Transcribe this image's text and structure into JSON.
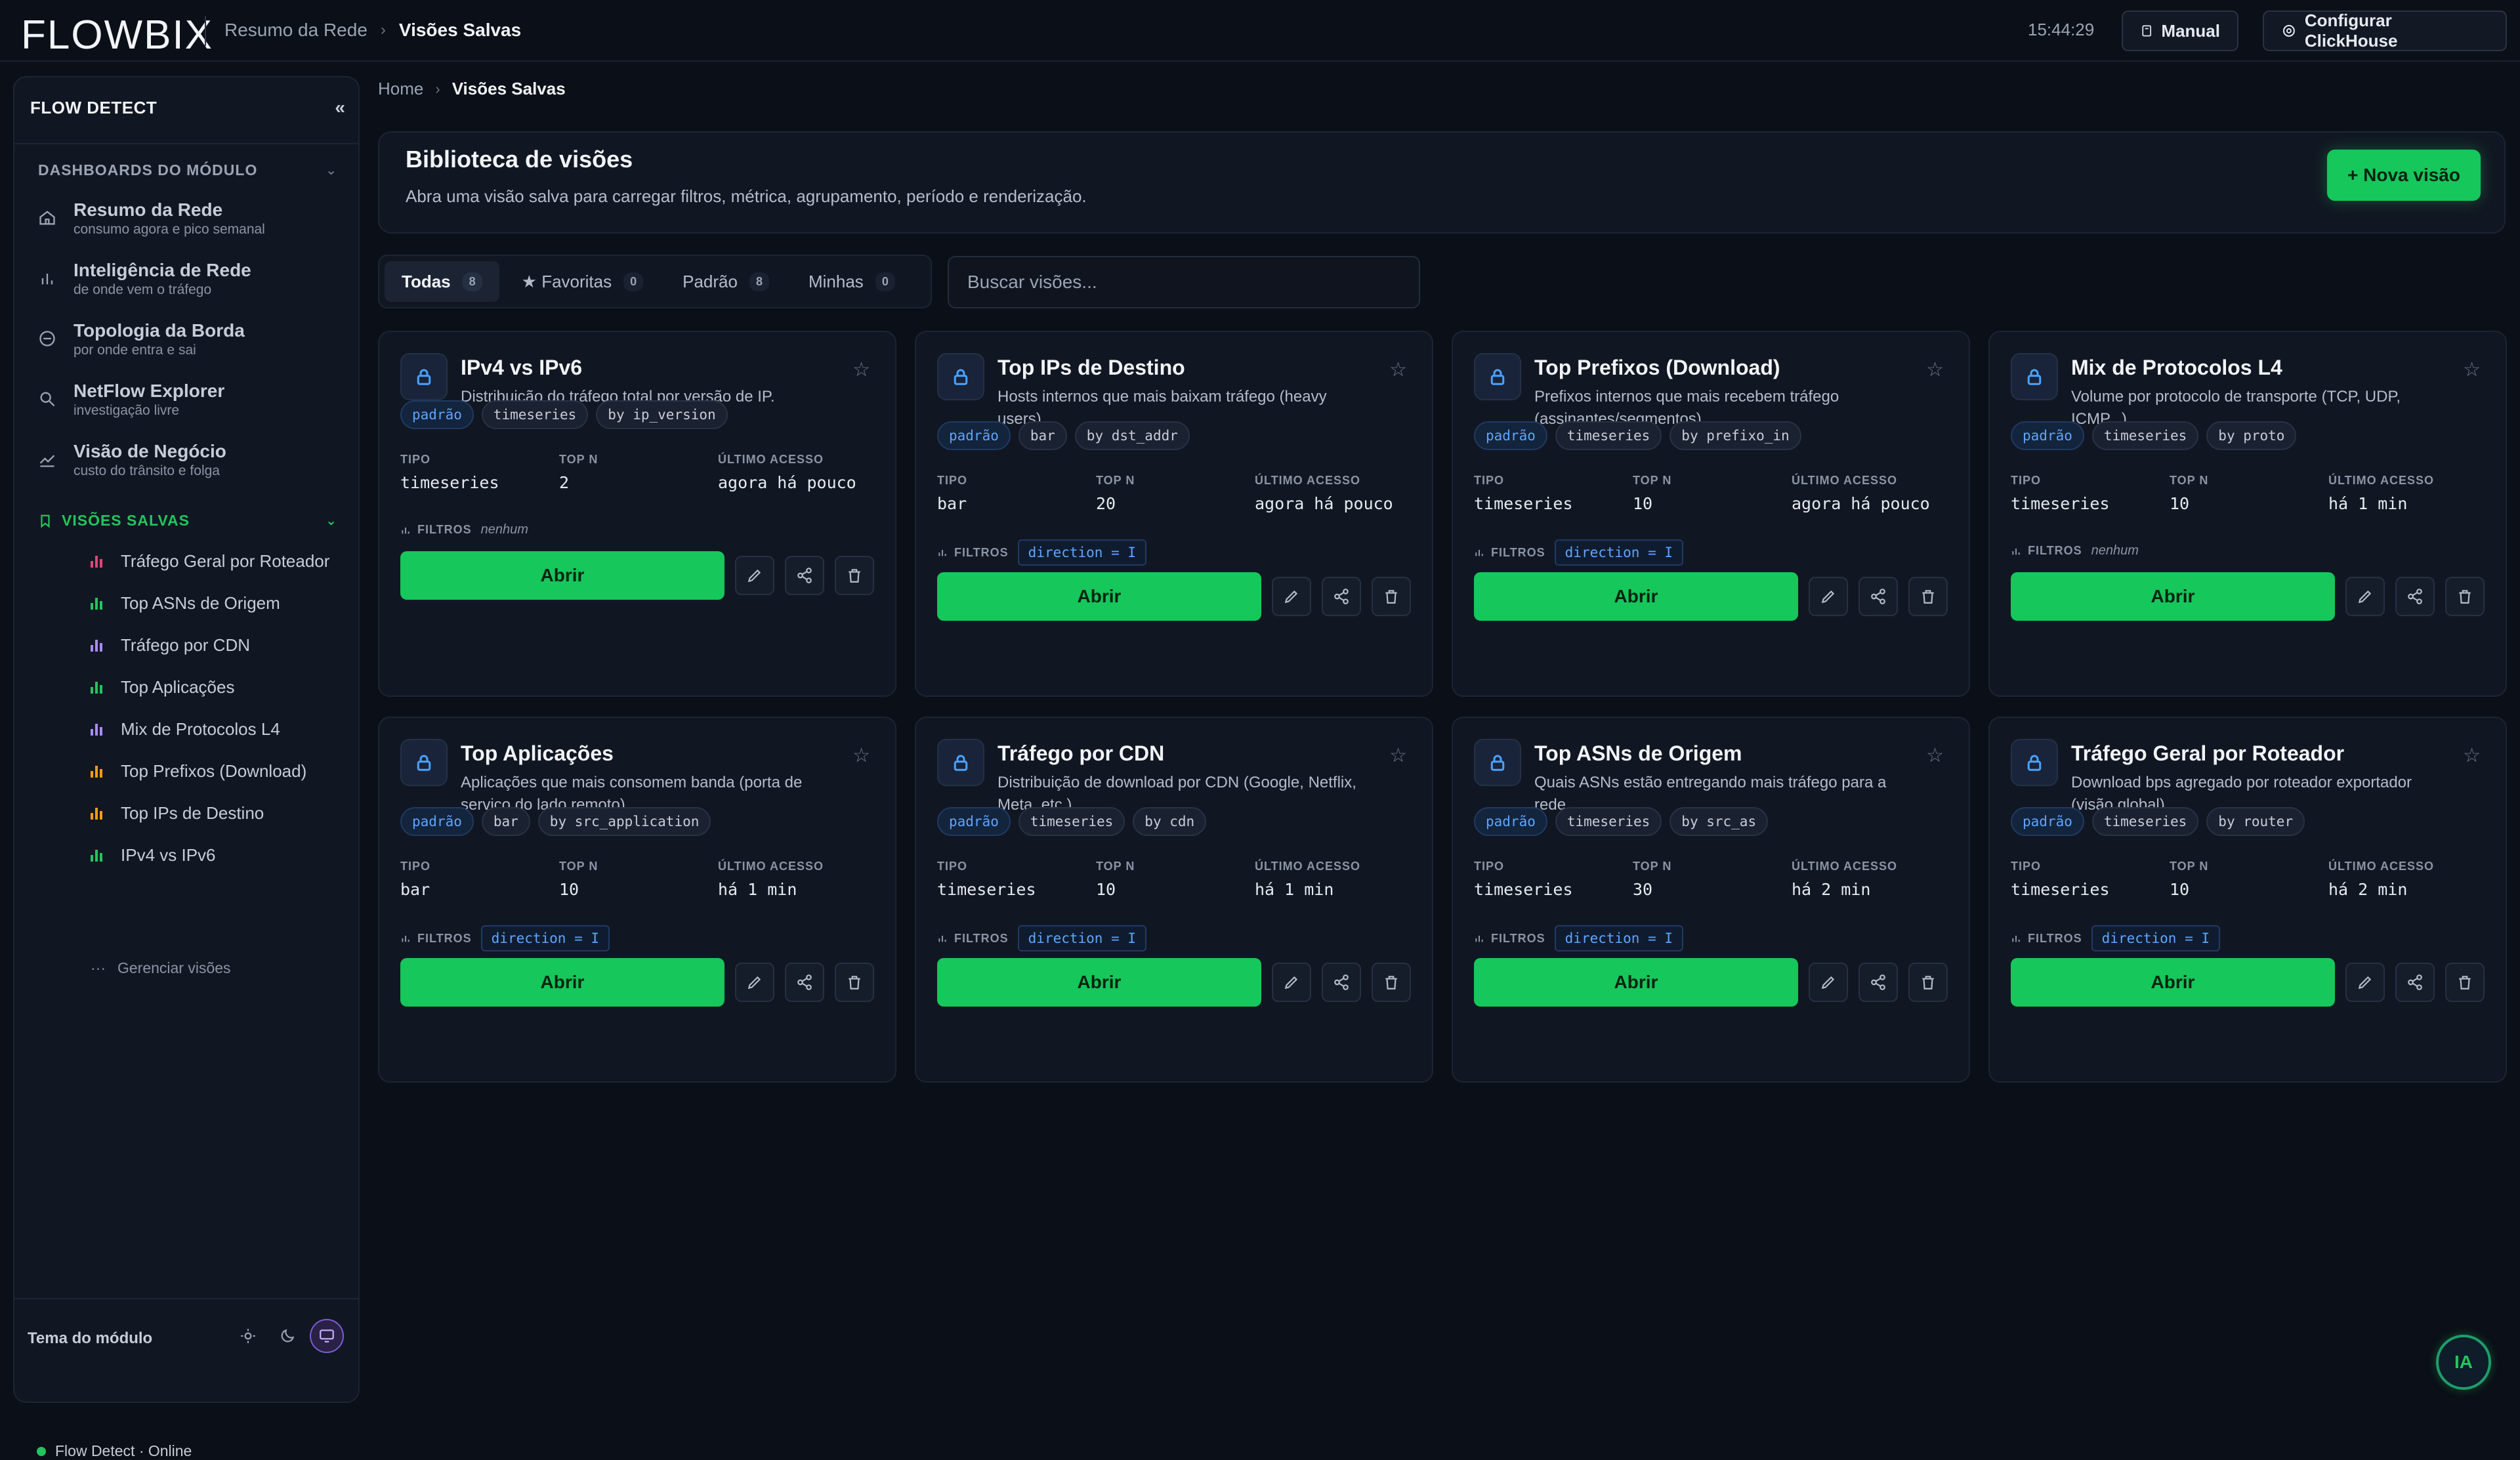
{
  "app": {
    "logo": "FLOWBIX",
    "breadcrumb_parent": "Resumo da Rede",
    "breadcrumb_current": "Visões Salvas",
    "clock": "15:44:29",
    "manual_label": "Manual",
    "config_label": "Configurar ClickHouse"
  },
  "sidebar": {
    "title": "FLOW DETECT",
    "collapse": "«",
    "section_dashboards": "DASHBOARDS DO MÓDULO",
    "nav": [
      {
        "label": "Resumo da Rede",
        "sub": "consumo agora e pico semanal",
        "icon": "home-icon"
      },
      {
        "label": "Inteligência de Rede",
        "sub": "de onde vem o tráfego",
        "icon": "bar-chart-icon"
      },
      {
        "label": "Topologia da Borda",
        "sub": "por onde entra e sai",
        "icon": "network-icon"
      },
      {
        "label": "NetFlow Explorer",
        "sub": "investigação livre",
        "icon": "search-icon"
      },
      {
        "label": "Visão de Negócio",
        "sub": "custo do trânsito e folga",
        "icon": "trend-icon"
      }
    ],
    "section_saved": "VISÕES SALVAS",
    "saved": [
      {
        "label": "Tráfego Geral por Roteador",
        "color": "#e0457b"
      },
      {
        "label": "Top ASNs de Origem",
        "color": "#22c55e"
      },
      {
        "label": "Tráfego por CDN",
        "color": "#a78bfa"
      },
      {
        "label": "Top Aplicações",
        "color": "#22c55e"
      },
      {
        "label": "Mix de Protocolos L4",
        "color": "#a78bfa"
      },
      {
        "label": "Top Prefixos (Download)",
        "color": "#f59e0b"
      },
      {
        "label": "Top IPs de Destino",
        "color": "#f59e0b"
      },
      {
        "label": "IPv4 vs IPv6",
        "color": "#22c55e"
      }
    ],
    "manage": "Gerenciar visões",
    "theme_label": "Tema do módulo",
    "status": "Flow Detect · Online"
  },
  "main": {
    "bc_home": "Home",
    "bc_current": "Visões Salvas",
    "lib_title": "Biblioteca de visões",
    "lib_desc": "Abra uma visão salva para carregar filtros, métrica, agrupamento, período e renderização.",
    "new_button": "+ Nova visão",
    "tabs": [
      {
        "label": "Todas",
        "count": "8"
      },
      {
        "label": "★ Favoritas",
        "count": "0"
      },
      {
        "label": "Padrão",
        "count": "8"
      },
      {
        "label": "Minhas",
        "count": "0"
      }
    ],
    "search_placeholder": "Buscar visões...",
    "labels": {
      "tipo": "TIPO",
      "topn": "TOP N",
      "last": "ÚLTIMO ACESSO",
      "filters": "FILTROS",
      "open": "Abrir",
      "none": "nenhum",
      "star": "☆"
    },
    "cards": [
      {
        "title": "IPv4 vs IPv6",
        "desc": "Distribuição do tráfego total por versão de IP.",
        "tags": [
          "padrão",
          "timeseries",
          "by ip_version"
        ],
        "tipo": "timeseries",
        "topn": "2",
        "last": "agora há pouco",
        "filter": ""
      },
      {
        "title": "Top IPs de Destino",
        "desc": "Hosts internos que mais baixam tráfego (heavy users).",
        "tags": [
          "padrão",
          "bar",
          "by dst_addr"
        ],
        "tipo": "bar",
        "topn": "20",
        "last": "agora há pouco",
        "filter": "direction = I"
      },
      {
        "title": "Top Prefixos (Download)",
        "desc": "Prefixos internos que mais recebem tráfego (assinantes/segmentos).",
        "tags": [
          "padrão",
          "timeseries",
          "by prefixo_in"
        ],
        "tipo": "timeseries",
        "topn": "10",
        "last": "agora há pouco",
        "filter": "direction = I"
      },
      {
        "title": "Mix de Protocolos L4",
        "desc": "Volume por protocolo de transporte (TCP, UDP, ICMP...).",
        "tags": [
          "padrão",
          "timeseries",
          "by proto"
        ],
        "tipo": "timeseries",
        "topn": "10",
        "last": "há 1 min",
        "filter": ""
      },
      {
        "title": "Top Aplicações",
        "desc": "Aplicações que mais consomem banda (porta de serviço do lado remoto).",
        "tags": [
          "padrão",
          "bar",
          "by src_application"
        ],
        "tipo": "bar",
        "topn": "10",
        "last": "há 1 min",
        "filter": "direction = I"
      },
      {
        "title": "Tráfego por CDN",
        "desc": "Distribuição de download por CDN (Google, Netflix, Meta, etc.).",
        "tags": [
          "padrão",
          "timeseries",
          "by cdn"
        ],
        "tipo": "timeseries",
        "topn": "10",
        "last": "há 1 min",
        "filter": "direction = I"
      },
      {
        "title": "Top ASNs de Origem",
        "desc": "Quais ASNs estão entregando mais tráfego para a rede.",
        "tags": [
          "padrão",
          "timeseries",
          "by src_as"
        ],
        "tipo": "timeseries",
        "topn": "30",
        "last": "há 2 min",
        "filter": "direction = I"
      },
      {
        "title": "Tráfego Geral por Roteador",
        "desc": "Download bps agregado por roteador exportador (visão global).",
        "tags": [
          "padrão",
          "timeseries",
          "by router"
        ],
        "tipo": "timeseries",
        "topn": "10",
        "last": "há 2 min",
        "filter": "direction = I"
      }
    ]
  },
  "assistant": {
    "label": "IA"
  }
}
